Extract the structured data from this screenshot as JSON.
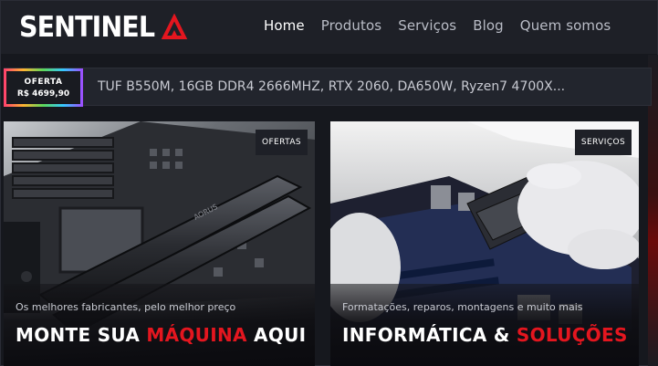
{
  "brand": {
    "name": "SENTINEL",
    "accent_color": "#e4161f"
  },
  "nav": {
    "items": [
      {
        "label": "Home",
        "active": true
      },
      {
        "label": "Produtos",
        "active": false
      },
      {
        "label": "Serviços",
        "active": false
      },
      {
        "label": "Blog",
        "active": false
      },
      {
        "label": "Quem somos",
        "active": false
      }
    ]
  },
  "offer": {
    "label": "OFERTA",
    "price": "R$ 4699,90",
    "description": "TUF B550M, 16GB DDR4 2666MHZ, RTX 2060, DA650W, Ryzen7 4700X..."
  },
  "cards": [
    {
      "tag": "OFERTAS",
      "subtitle": "Os melhores fabricantes, pelo melhor preço",
      "title_part1": "MONTE SUA ",
      "title_accent": "MÁQUINA",
      "title_part2": " AQUI",
      "image": "motherboard-ram-photo"
    },
    {
      "tag": "SERVIÇOS",
      "subtitle": "Formatações, reparos, montagens e muito mais",
      "title_part1": "INFORMÁTICA & ",
      "title_accent": "SOLUÇÕES",
      "title_part2": "",
      "image": "technician-installing-cooler-photo"
    }
  ]
}
